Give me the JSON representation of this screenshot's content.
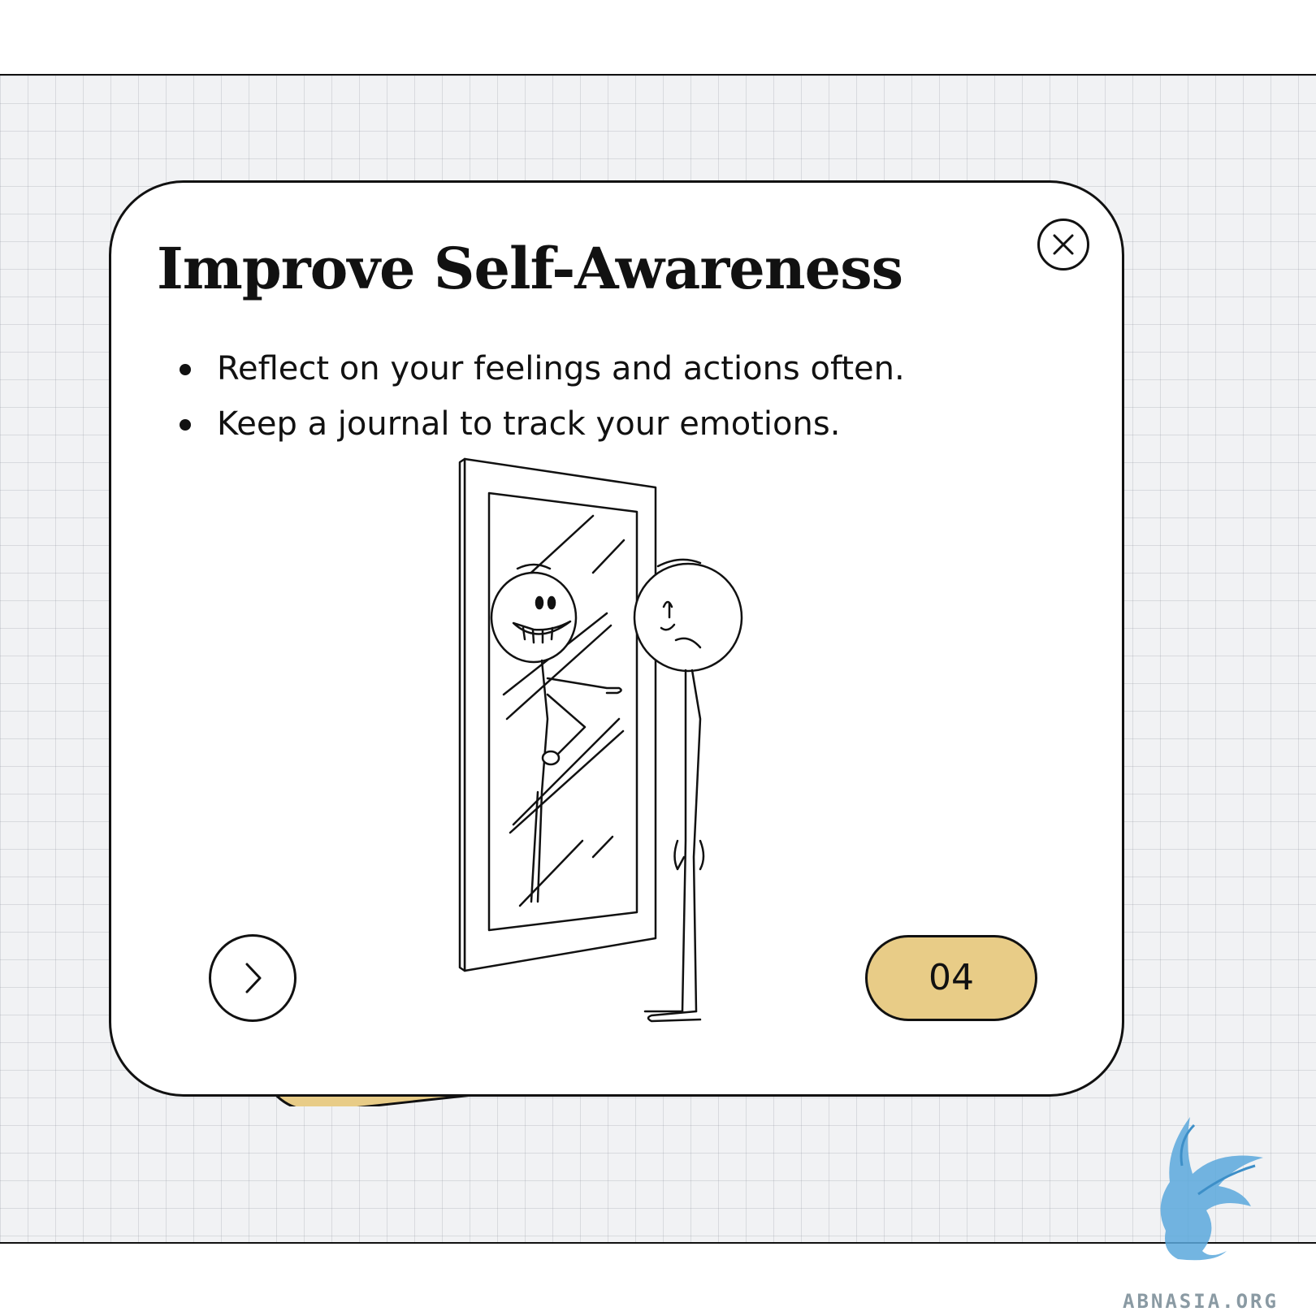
{
  "card": {
    "title": "Improve Self-Awareness",
    "bullets": [
      "Reflect on your feelings and actions often.",
      "Keep a journal to track your emotions."
    ],
    "page_number": "04"
  },
  "icons": {
    "close": "close-icon",
    "next": "chevron-right-icon",
    "illustration": "stick-figure-mirror-illustration",
    "brand_logo": "griffin-logo"
  },
  "branding": {
    "site": "ABNASIA.ORG"
  },
  "colors": {
    "accent": "#e8cc87",
    "ink": "#111111",
    "grid_background": "#f1f2f4",
    "brand": "#5aa8dc"
  }
}
